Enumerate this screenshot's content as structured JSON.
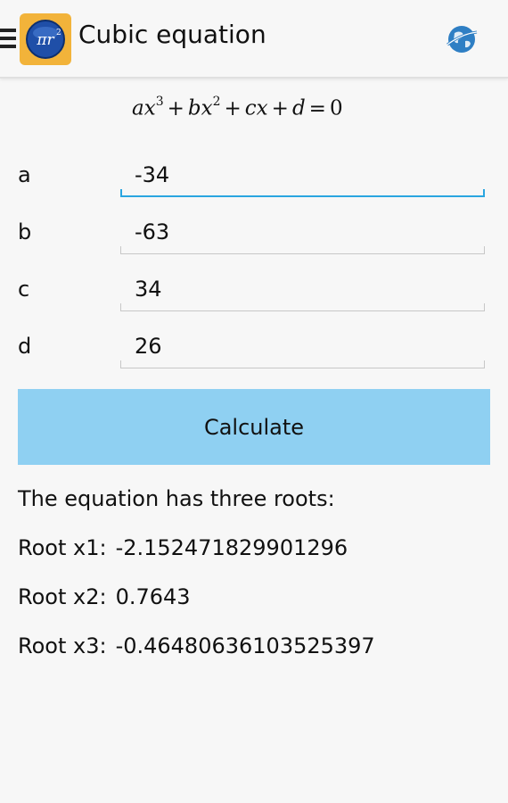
{
  "header": {
    "title": "Cubic equation",
    "app_icon": "pi-r-squared-app-icon",
    "menu_icon": "hamburger-menu-icon",
    "globe_icon": "globe-icon"
  },
  "formula": {
    "text": "ax³ + bx² + cx + d = 0"
  },
  "fields": {
    "a": {
      "label": "a",
      "value": "-34"
    },
    "b": {
      "label": "b",
      "value": "-63"
    },
    "c": {
      "label": "c",
      "value": "34"
    },
    "d": {
      "label": "d",
      "value": "26"
    }
  },
  "calculate_label": "Calculate",
  "results": {
    "summary": "The equation has three roots:",
    "roots": [
      {
        "label": "Root x1:",
        "value": "-2.152471829901296"
      },
      {
        "label": "Root x2:",
        "value": "0.7643"
      },
      {
        "label": "Root x3:",
        "value": "-0.46480636103525397"
      }
    ]
  },
  "colors": {
    "accent": "#2aa6e0",
    "button": "#8fd0f2",
    "app_icon_bg": "#f2b33a",
    "globe": "#2f7fc4"
  }
}
